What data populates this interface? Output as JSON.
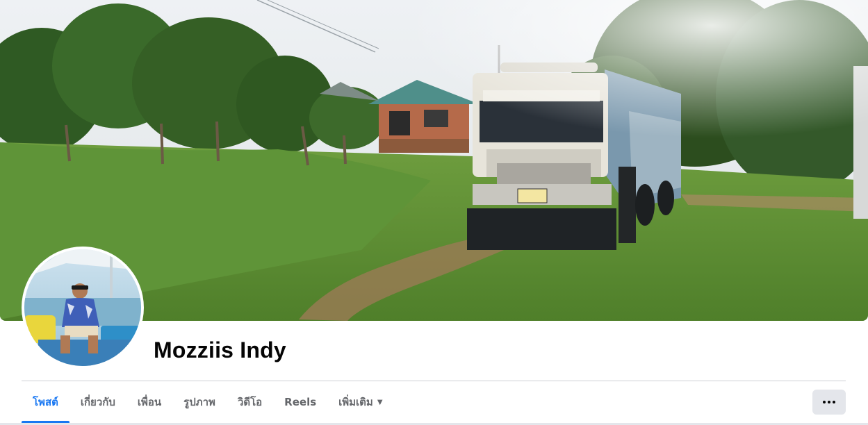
{
  "profile": {
    "name": "Mozziis Indy"
  },
  "tabs": [
    {
      "label": "โพสต์",
      "active": true
    },
    {
      "label": "เกี่ยวกับ",
      "active": false
    },
    {
      "label": "เพื่อน",
      "active": false
    },
    {
      "label": "รูปภาพ",
      "active": false
    },
    {
      "label": "วิดีโอ",
      "active": false
    },
    {
      "label": "Reels",
      "active": false
    },
    {
      "label": "เพิ่มเติม",
      "active": false,
      "dropdown": true
    }
  ],
  "more_button": {
    "icon": "more-horizontal-icon"
  },
  "colors": {
    "accent": "#1877f2",
    "tab_text": "#65676b",
    "name_text": "#050505",
    "button_bg": "#e4e6eb"
  }
}
